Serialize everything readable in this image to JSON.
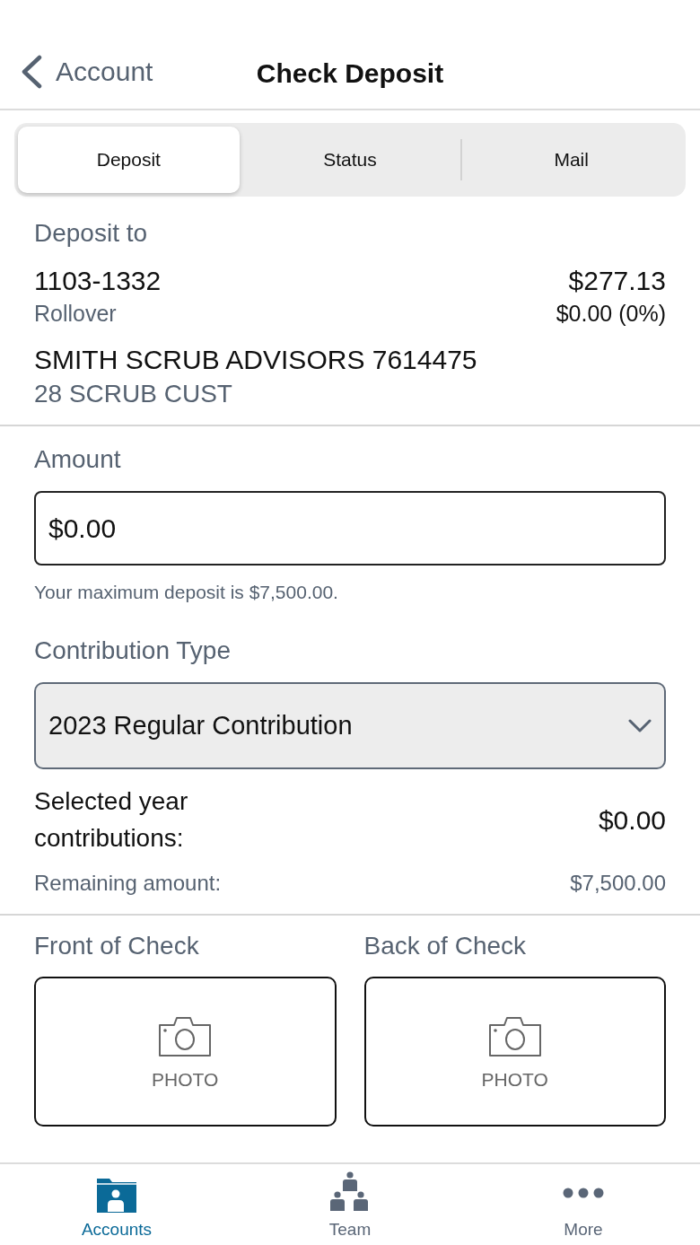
{
  "nav": {
    "back_label": "Account",
    "title": "Check Deposit"
  },
  "segments": [
    {
      "label": "Deposit",
      "selected": true
    },
    {
      "label": "Status",
      "selected": false
    },
    {
      "label": "Mail",
      "selected": false
    }
  ],
  "deposit_to": {
    "heading": "Deposit to",
    "account_number": "1103-1332",
    "account_type": "Rollover",
    "balance": "$277.13",
    "change": "$0.00 (0%)",
    "owner": "SMITH SCRUB ADVISORS 7614475",
    "custodian": "28 SCRUB CUST"
  },
  "amount": {
    "label": "Amount",
    "value": "$0.00",
    "hint": "Your maximum deposit is $7,500.00."
  },
  "contribution": {
    "label": "Contribution Type",
    "value": "2023 Regular Contribution",
    "summary": [
      {
        "label": "Selected year contributions:",
        "value": "$0.00",
        "kind": "primary"
      },
      {
        "label": "Remaining amount:",
        "value": "$7,500.00",
        "kind": "secondary"
      }
    ]
  },
  "check_images": [
    {
      "label": "Front of Check",
      "button": "PHOTO"
    },
    {
      "label": "Back of Check",
      "button": "PHOTO"
    }
  ],
  "tab_bar": [
    {
      "label": "Accounts",
      "selected": true,
      "kind": "accounts"
    },
    {
      "label": "Team",
      "selected": false,
      "kind": "team"
    },
    {
      "label": "More",
      "selected": false,
      "kind": "more"
    }
  ]
}
